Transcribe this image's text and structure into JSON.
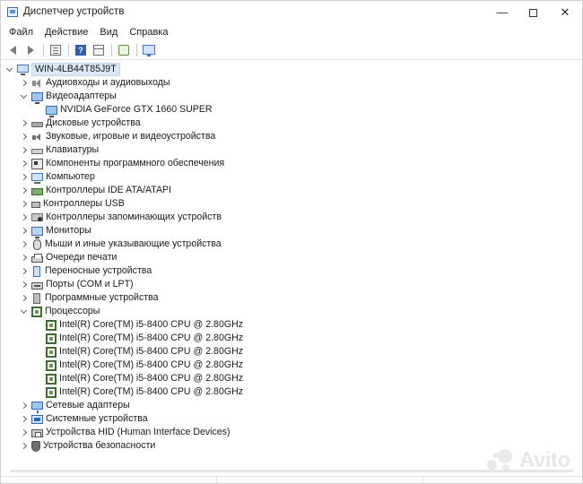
{
  "window": {
    "title": "Диспетчер устройств",
    "minimize_glyph": "—",
    "close_glyph": "✕"
  },
  "menu": [
    {
      "label": "Файл"
    },
    {
      "label": "Действие"
    },
    {
      "label": "Вид"
    },
    {
      "label": "Справка"
    }
  ],
  "toolbar": {
    "icons": [
      "back-arrow-icon",
      "forward-arrow-icon",
      "properties-icon",
      "help-icon",
      "view-grid-icon",
      "scan-hardware-icon",
      "monitor-icon"
    ]
  },
  "tree": {
    "root": "WIN-4LB44T85J9T",
    "categories": [
      {
        "label": "Аудиовходы и аудиовыходы",
        "icon": "audio-icon",
        "expanded": false
      },
      {
        "label": "Видеоадаптеры",
        "icon": "display-adapter-icon",
        "expanded": true,
        "children": [
          "NVIDIA GeForce GTX 1660 SUPER"
        ]
      },
      {
        "label": "Дисковые устройства",
        "icon": "disk-drive-icon",
        "expanded": false
      },
      {
        "label": "Звуковые, игровые и видеоустройства",
        "icon": "sound-icon",
        "expanded": false
      },
      {
        "label": "Клавиатуры",
        "icon": "keyboard-icon",
        "expanded": false
      },
      {
        "label": "Компоненты программного обеспечения",
        "icon": "software-component-icon",
        "expanded": false
      },
      {
        "label": "Компьютер",
        "icon": "computer-icon",
        "expanded": false
      },
      {
        "label": "Контроллеры IDE ATA/ATAPI",
        "icon": "ide-controller-icon",
        "expanded": false
      },
      {
        "label": "Контроллеры USB",
        "icon": "usb-icon",
        "expanded": false
      },
      {
        "label": "Контроллеры запоминающих устройств",
        "icon": "storage-controller-icon",
        "expanded": false
      },
      {
        "label": "Мониторы",
        "icon": "monitor-icon",
        "expanded": false
      },
      {
        "label": "Мыши и иные указывающие устройства",
        "icon": "mouse-icon",
        "expanded": false
      },
      {
        "label": "Очереди печати",
        "icon": "printer-icon",
        "expanded": false
      },
      {
        "label": "Переносные устройства",
        "icon": "portable-device-icon",
        "expanded": false
      },
      {
        "label": "Порты (COM и LPT)",
        "icon": "ports-icon",
        "expanded": false
      },
      {
        "label": "Программные устройства",
        "icon": "software-device-icon",
        "expanded": false
      },
      {
        "label": "Процессоры",
        "icon": "processor-icon",
        "expanded": true,
        "children": [
          "Intel(R) Core(TM) i5-8400 CPU @ 2.80GHz",
          "Intel(R) Core(TM) i5-8400 CPU @ 2.80GHz",
          "Intel(R) Core(TM) i5-8400 CPU @ 2.80GHz",
          "Intel(R) Core(TM) i5-8400 CPU @ 2.80GHz",
          "Intel(R) Core(TM) i5-8400 CPU @ 2.80GHz",
          "Intel(R) Core(TM) i5-8400 CPU @ 2.80GHz"
        ]
      },
      {
        "label": "Сетевые адаптеры",
        "icon": "network-adapter-icon",
        "expanded": false
      },
      {
        "label": "Системные устройства",
        "icon": "system-device-icon",
        "expanded": false
      },
      {
        "label": "Устройства HID (Human Interface Devices)",
        "icon": "hid-icon",
        "expanded": false
      },
      {
        "label": "Устройства безопасности",
        "icon": "security-device-icon",
        "expanded": false
      }
    ]
  },
  "watermark": {
    "text": "Avito"
  },
  "colors": {
    "selection": "#dbe8f7",
    "accent": "#2f68b5",
    "cpu_green": "#3e6b2e"
  }
}
